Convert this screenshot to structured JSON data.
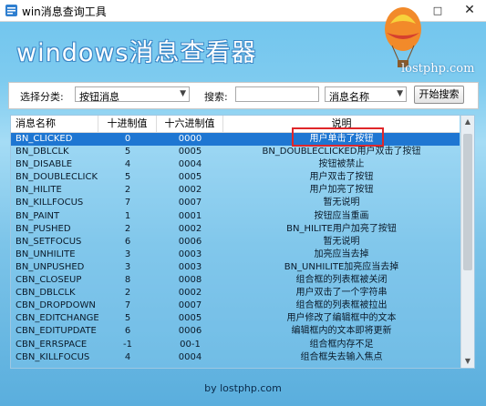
{
  "window": {
    "title": "win消息查询工具"
  },
  "banner": {
    "logo_text": "windows消息查看器",
    "site_text": "lostphp.com"
  },
  "filter": {
    "category_label": "选择分类:",
    "category_value": "按钮消息",
    "search_label": "搜索:",
    "search_value": "",
    "field_value": "消息名称",
    "search_button": "开始搜索"
  },
  "table": {
    "columns": [
      "消息名称",
      "十进制值",
      "十六进制值",
      "说明"
    ],
    "selected_index": 0,
    "rows": [
      [
        "BN_CLICKED",
        "0",
        "0000",
        "用户单击了按钮"
      ],
      [
        "BN_DBLCLK",
        "5",
        "0005",
        "BN_DOUBLECLICKED用户双击了按钮"
      ],
      [
        "BN_DISABLE",
        "4",
        "0004",
        "按钮被禁止"
      ],
      [
        "BN_DOUBLECLICK...",
        "5",
        "0005",
        "用户双击了按钮"
      ],
      [
        "BN_HILITE",
        "2",
        "0002",
        "用户加亮了按钮"
      ],
      [
        "BN_KILLFOCUS",
        "7",
        "0007",
        "暂无说明"
      ],
      [
        "BN_PAINT",
        "1",
        "0001",
        "按钮应当重画"
      ],
      [
        "BN_PUSHED",
        "2",
        "0002",
        "BN_HILITE用户加亮了按钮"
      ],
      [
        "BN_SETFOCUS",
        "6",
        "0006",
        "暂无说明"
      ],
      [
        "BN_UNHILITE",
        "3",
        "0003",
        "加亮应当去掉"
      ],
      [
        "BN_UNPUSHED",
        "3",
        "0003",
        "BN_UNHILITE加亮应当去掉"
      ],
      [
        "CBN_CLOSEUP",
        "8",
        "0008",
        "组合框的列表框被关闭"
      ],
      [
        "CBN_DBLCLK",
        "2",
        "0002",
        "用户双击了一个字符串"
      ],
      [
        "CBN_DROPDOWN",
        "7",
        "0007",
        "组合框的列表框被拉出"
      ],
      [
        "CBN_EDITCHANGE",
        "5",
        "0005",
        "用户修改了编辑框中的文本"
      ],
      [
        "CBN_EDITUPDATE",
        "6",
        "0006",
        "编辑框内的文本即将更新"
      ],
      [
        "CBN_ERRSPACE",
        "-1",
        "00-1",
        "组合框内存不足"
      ],
      [
        "CBN_KILLFOCUS",
        "4",
        "0004",
        "组合框失去输入焦点"
      ]
    ]
  },
  "footer": {
    "text": "by lostphp.com"
  }
}
